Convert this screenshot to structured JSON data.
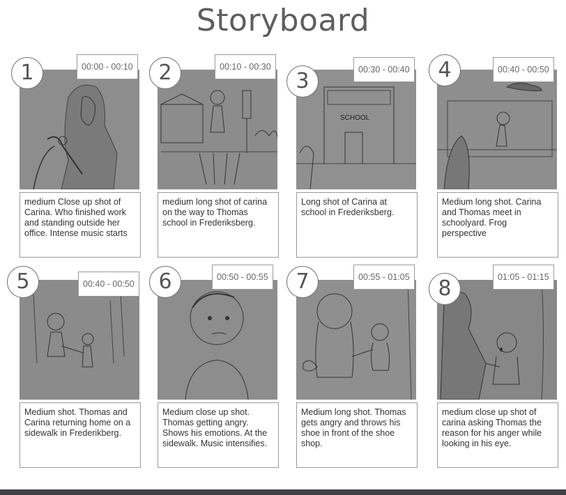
{
  "title": "Storyboard",
  "panels": [
    {
      "number": "1",
      "time": "00:00 - 00:10",
      "caption": "medium Close up shot of Carina. Who finished work and standing outside her office. Intense music starts"
    },
    {
      "number": "2",
      "time": "00:10 - 00:30",
      "caption": "medium long shot of carina on the way to Thomas school in Frederiksberg."
    },
    {
      "number": "3",
      "time": "00:30 - 00:40",
      "caption": "Long shot of Carina at school in Frederiksberg."
    },
    {
      "number": "4",
      "time": "00:40 - 00:50",
      "caption": "Medium long shot. Carina and Thomas meet in schoolyard. Frog perspective"
    },
    {
      "number": "5",
      "time": "00:40 - 00:50",
      "caption": "Medium shot. Thomas and Carina returning home on a sidewalk in Frederikberg."
    },
    {
      "number": "6",
      "time": "00:50 - 00:55",
      "caption": "Medium close up shot. Thomas getting angry. Shows his emotions. At the sidewalk. Music intensifies."
    },
    {
      "number": "7",
      "time": "00:55 - 01:05",
      "caption": "Medium long shot. Thomas gets angry and throws his shoe in front of the shoe shop."
    },
    {
      "number": "8",
      "time": "01:05 - 01:15",
      "caption": "medium close up shot of carina asking Thomas the reason for his anger while looking in his eye."
    }
  ],
  "sketch_text": {
    "school_sign": "SCHOOL"
  }
}
